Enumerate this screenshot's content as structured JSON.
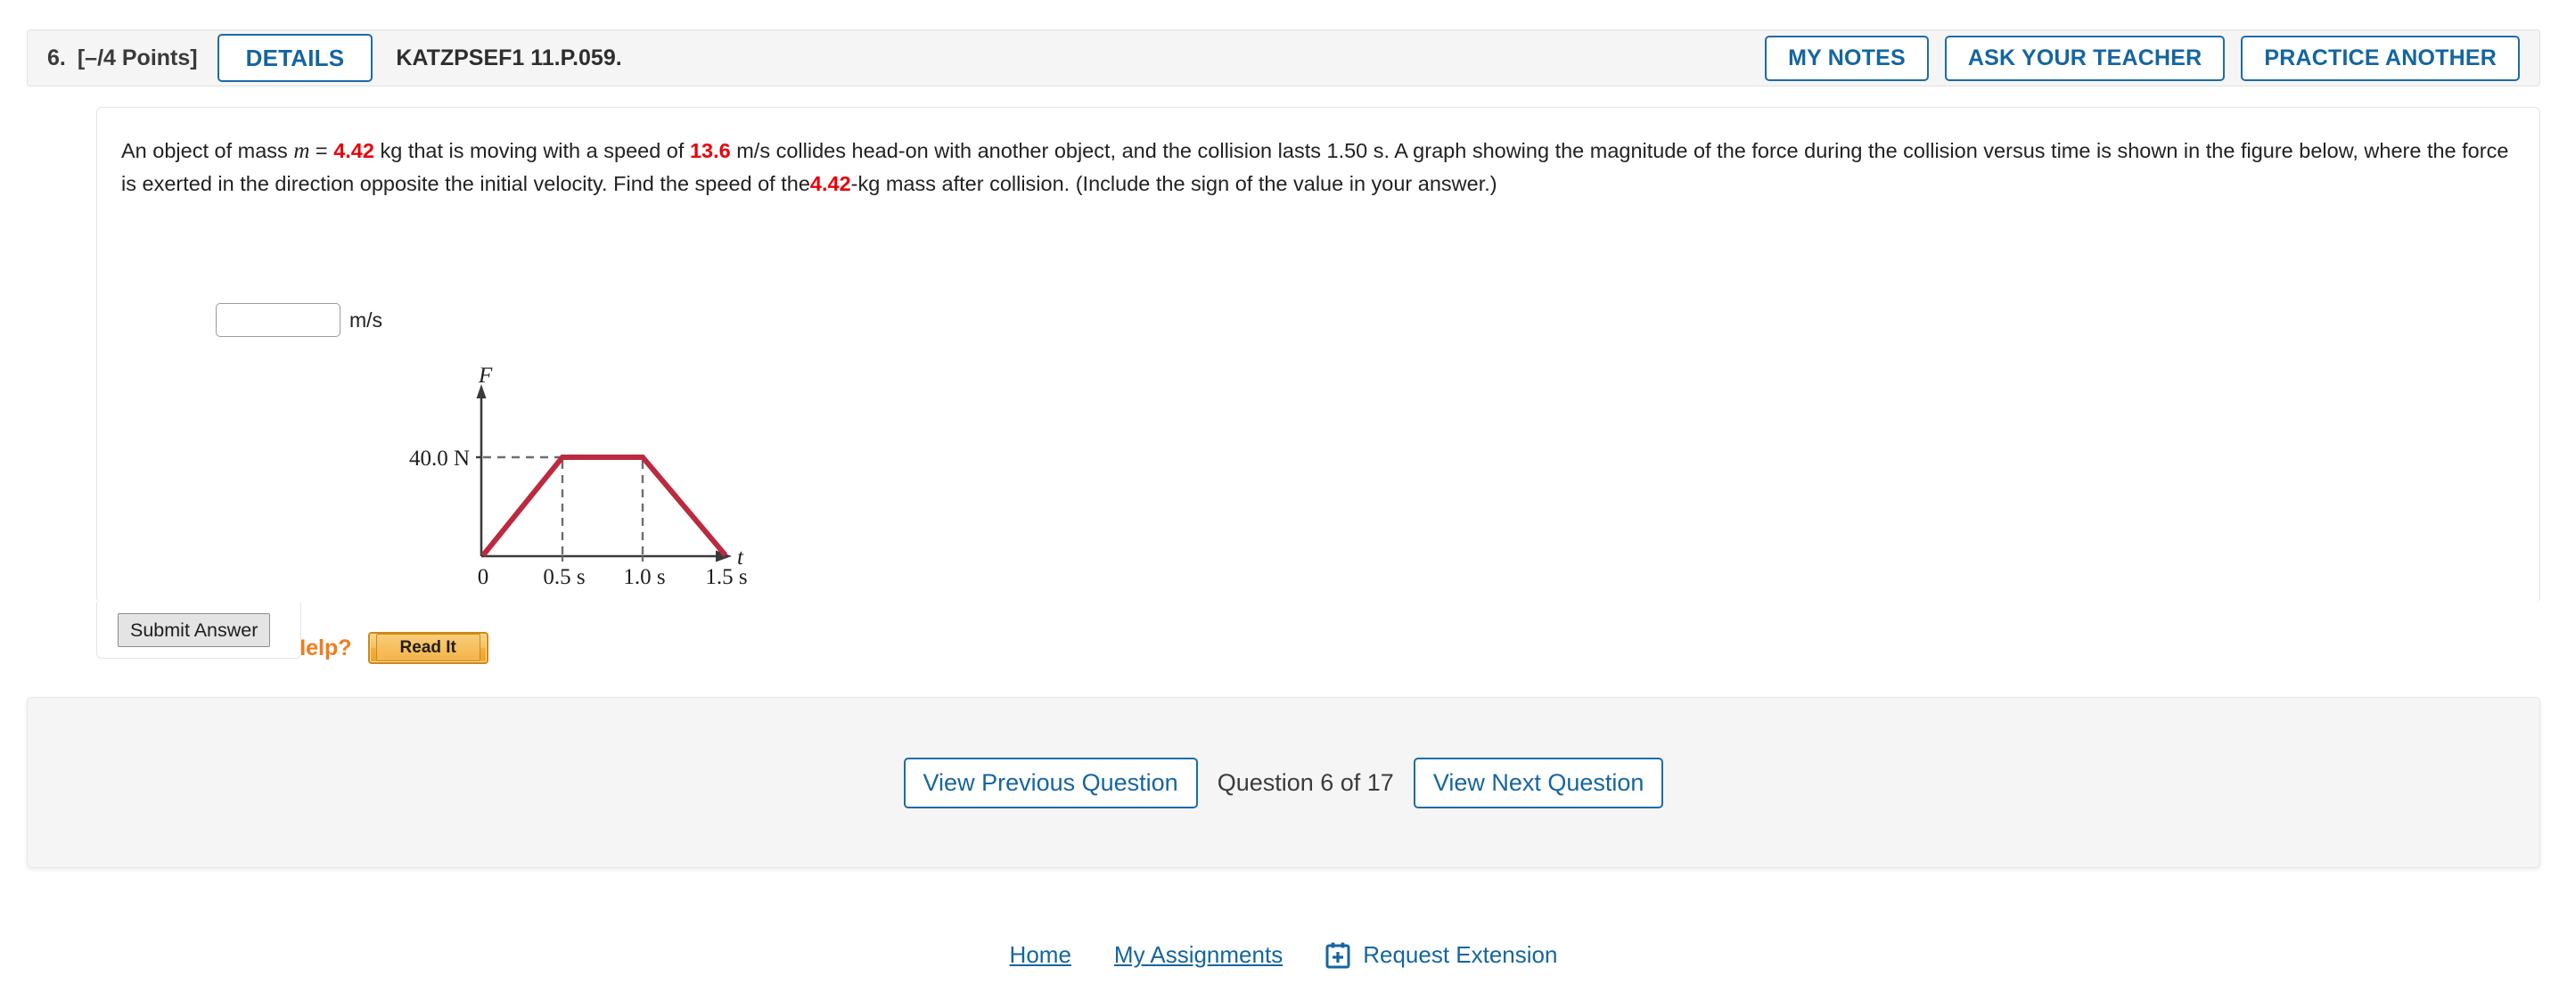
{
  "header": {
    "question_number": "6.",
    "points": "[–/4 Points]",
    "details_label": "DETAILS",
    "question_code": "KATZPSEF1 11.P.059.",
    "my_notes_label": "MY NOTES",
    "ask_teacher_label": "ASK YOUR TEACHER",
    "practice_another_label": "PRACTICE ANOTHER"
  },
  "question": {
    "text_part1": "An object of mass",
    "var_m": "m",
    "equals": "=",
    "mass_value": "4.42",
    "text_part2": "kg  that is moving with a speed of",
    "speed_value": "13.6",
    "text_part3": "m/s collides head-on with another object, and the collision lasts 1.50 s. A graph showing the magnitude of the force during the collision versus time is shown in the figure below, where the force is exerted in the direction opposite the initial velocity. Find the speed of the",
    "mass_value2": "4.42",
    "text_part4": "-kg mass after collision. (Include the sign of the value in your answer.)",
    "answer_value": "",
    "answer_placeholder": "",
    "answer_unit": "m/s"
  },
  "chart_data": {
    "type": "line",
    "title": "",
    "xlabel": "t",
    "ylabel": "F",
    "x": [
      0,
      0.5,
      1.0,
      1.5
    ],
    "values": [
      0,
      40.0,
      40.0,
      0
    ],
    "xtick_labels": [
      "0",
      "0.5 s",
      "1.0 s",
      "1.5 s"
    ],
    "ytick_labels": [
      "40.0 N"
    ],
    "yticks": [
      40.0
    ],
    "xlim": [
      0,
      1.7
    ],
    "ylim": [
      0,
      52
    ],
    "grid": false,
    "legend": "none",
    "line_color": "#bb2a3f",
    "dashed_guide_color": "#6e6e6e",
    "axis_color": "#3a3a3a",
    "annotations": [
      "dashed horizontal guide at F = 40.0 N",
      "dashed vertical guides at t = 0.5 s and t = 1.0 s"
    ]
  },
  "help": {
    "need_help_label": "Need Help?",
    "read_it_label": "Read It"
  },
  "submit": {
    "submit_label": "Submit Answer"
  },
  "nav": {
    "previous_label": "View Previous Question",
    "counter": "Question 6 of 17",
    "next_label": "View Next Question"
  },
  "footer": {
    "home_label": "Home",
    "my_assignments_label": "My Assignments",
    "request_extension_label": "Request Extension"
  },
  "colors": {
    "accent_blue": "#1565a0",
    "highlight_red": "#e8000a",
    "orange": "#f07c1e",
    "curve_red": "#bb2a3f",
    "panel_gray": "#f5f5f5"
  }
}
